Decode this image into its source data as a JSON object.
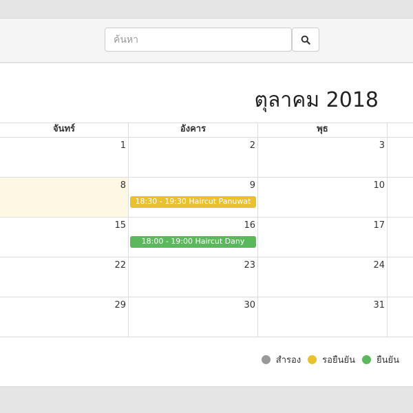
{
  "search": {
    "placeholder": "ค้นหา",
    "value": "",
    "button_icon": "search-icon"
  },
  "calendar": {
    "title": "ตุลาคม 2018",
    "columns": [
      "จันทร์",
      "อังคาร",
      "พุธ",
      ""
    ],
    "weeks": [
      [
        "1",
        "2",
        "3"
      ],
      [
        "8",
        "9",
        "10"
      ],
      [
        "15",
        "16",
        "17"
      ],
      [
        "22",
        "23",
        "24"
      ],
      [
        "29",
        "30",
        "31"
      ]
    ],
    "events": [
      {
        "label": "18:30 - 19:30 Haircut Panuwat",
        "status": "pending",
        "color": "#e8c130"
      },
      {
        "label": "18:00 - 19:00 Haircut Dany",
        "status": "confirmed",
        "color": "#5cb85c"
      }
    ],
    "today_color": "#fcf8e3"
  },
  "legend": {
    "items": [
      {
        "label": "สำรอง",
        "color": "#999999"
      },
      {
        "label": "รอยืนยัน",
        "color": "#e8c130"
      },
      {
        "label": "ยืนยัน",
        "color": "#5cb85c"
      }
    ]
  }
}
